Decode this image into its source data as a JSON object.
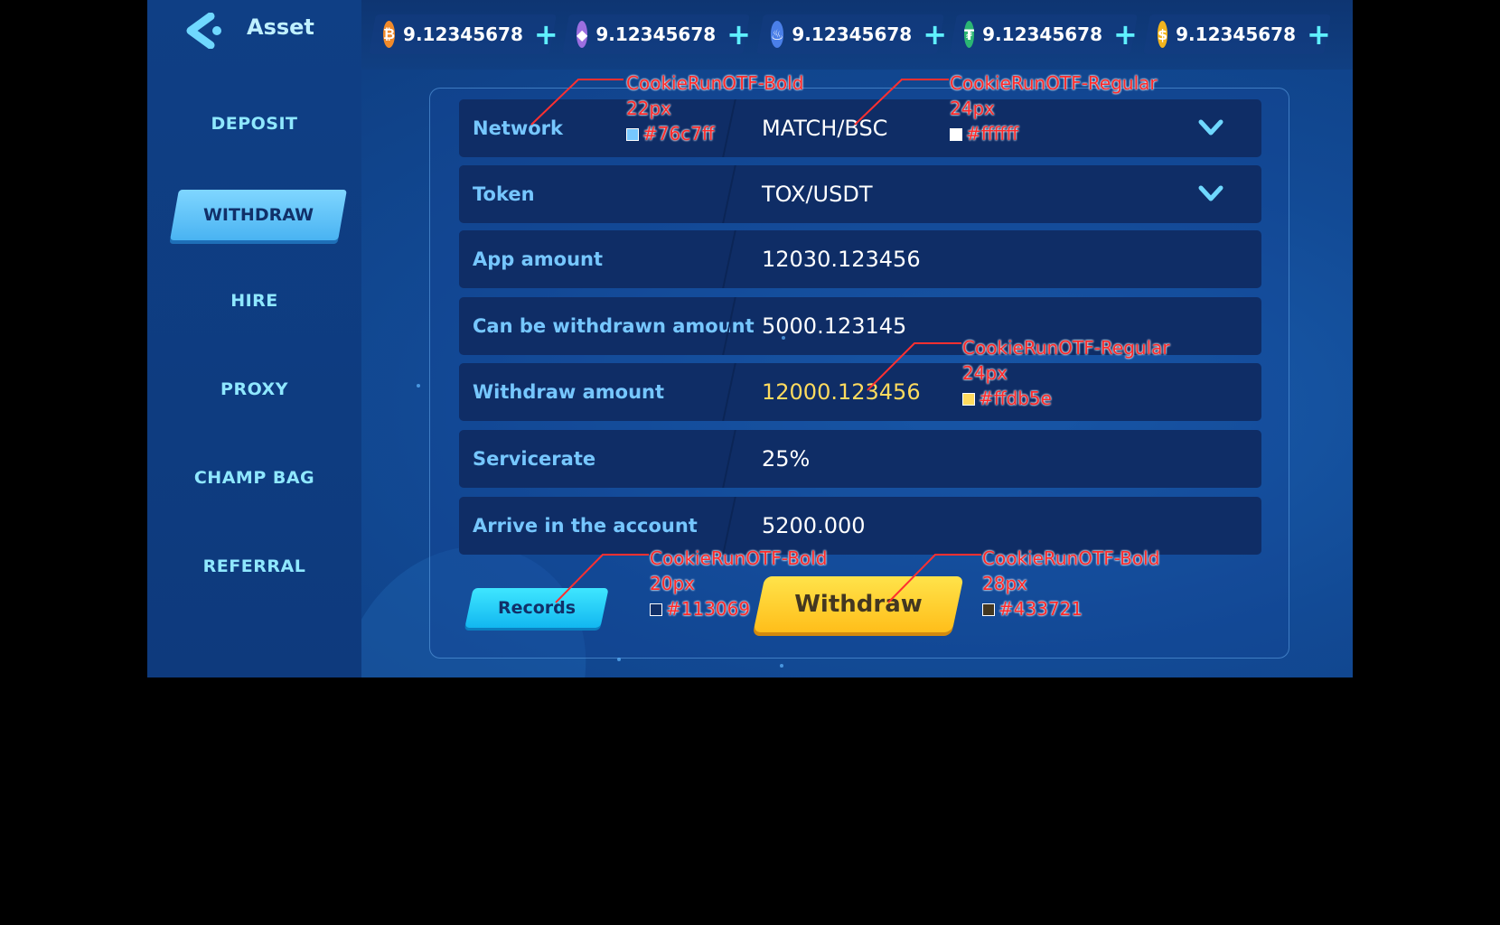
{
  "header": {
    "title": "Asset"
  },
  "currencies": [
    {
      "value": "9.12345678",
      "icon": "bitcoin-icon",
      "color": "#f08a2a",
      "glyph": "₿"
    },
    {
      "value": "9.12345678",
      "icon": "ethereum-icon",
      "color": "#9b6fe0",
      "glyph": "◆"
    },
    {
      "value": "9.12345678",
      "icon": "flame-icon",
      "color": "#4a7fe8",
      "glyph": "♨"
    },
    {
      "value": "9.12345678",
      "icon": "tether-icon",
      "color": "#2bb673",
      "glyph": "₮"
    },
    {
      "value": "9.12345678",
      "icon": "dollar-coin-icon",
      "color": "#f2b51e",
      "glyph": "$"
    }
  ],
  "sidebar": {
    "items": [
      {
        "label": "DEPOSIT"
      },
      {
        "label": "WITHDRAW",
        "active": true
      },
      {
        "label": "HIRE"
      },
      {
        "label": "PROXY"
      },
      {
        "label": "CHAMP BAG"
      },
      {
        "label": "REFERRAL"
      }
    ]
  },
  "form": {
    "rows": [
      {
        "label": "Network",
        "value": "MATCH/BSC",
        "dropdown": true
      },
      {
        "label": "Token",
        "value": "TOX/USDT",
        "dropdown": true
      },
      {
        "label": "App amount",
        "value": "12030.123456"
      },
      {
        "label": "Can be withdrawn amount",
        "value": "5000.123145"
      },
      {
        "label": "Withdraw amount",
        "value": "12000.123456",
        "highlight_color": "#ffdb5e"
      },
      {
        "label": "Servicerate",
        "value": "25%"
      },
      {
        "label": "Arrive in the account",
        "value": "5200.000"
      }
    ]
  },
  "buttons": {
    "records": "Records",
    "withdraw": "Withdraw"
  },
  "annotations": [
    {
      "font": "CookieRunOTF-Bold",
      "size": "22px",
      "color": "#76c7ff"
    },
    {
      "font": "CookieRunOTF-Regular",
      "size": "24px",
      "color": "#ffffff"
    },
    {
      "font": "CookieRunOTF-Regular",
      "size": "24px",
      "color": "#ffdb5e"
    },
    {
      "font": "CookieRunOTF-Bold",
      "size": "20px",
      "color": "#113069"
    },
    {
      "font": "CookieRunOTF-Bold",
      "size": "28px",
      "color": "#433721"
    }
  ],
  "colors": {
    "label": "#76c7ff",
    "value": "#ffffff",
    "highlight": "#ffdb5e",
    "records_text": "#113069",
    "withdraw_text": "#433721"
  }
}
